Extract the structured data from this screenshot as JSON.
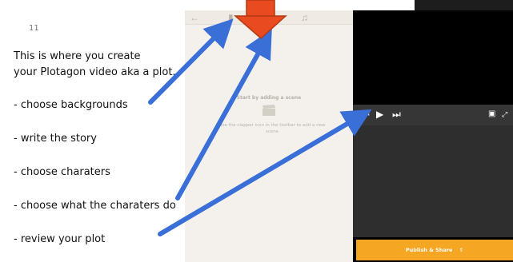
{
  "doc": {
    "page_number": "11",
    "lines": [
      "This is where you create",
      "your Plotagon video aka a plot.",
      "- choose backgrounds",
      "- write the story",
      "- choose charaters",
      "- choose what the charaters do",
      "- review your plot"
    ]
  },
  "editor": {
    "toolbar_icons": [
      "back-arrow-icon",
      "clapper-icon",
      "music-note-icon"
    ],
    "empty_title": "Start by adding a scene",
    "empty_desc": "Use the clapper icon in the toolbar to add a new scene",
    "background": "#f4f1ec"
  },
  "preview": {
    "controls": [
      "skip-back-icon",
      "play-icon",
      "skip-forward-icon"
    ],
    "right_icons": [
      "trash-icon",
      "fullscreen-icon"
    ],
    "publish_label": "Publish & Share",
    "publish_color": "#f5a623"
  },
  "annotations": {
    "arrow_color": "#3a6fd8",
    "big_arrow_color": "#e94a1f"
  }
}
